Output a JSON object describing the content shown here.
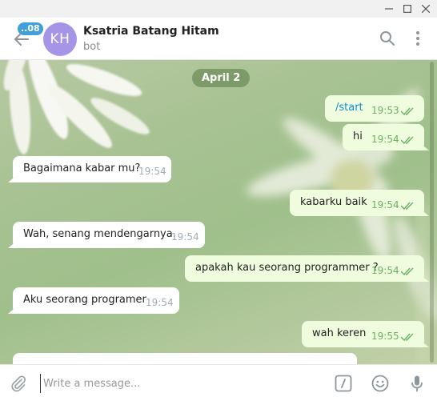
{
  "header": {
    "unread_count": "..08",
    "avatar_initials": "KH",
    "title": "Ksatria Batang Hitam",
    "subtitle": "bot"
  },
  "date_pill": "April 2",
  "messages": [
    {
      "text": "/start",
      "time": "19:53",
      "direction": "out"
    },
    {
      "text": "hi",
      "time": "19:54",
      "direction": "out"
    },
    {
      "text": "Bagaimana kabar mu?",
      "time": "19:54",
      "direction": "in"
    },
    {
      "text": "kabarku baik",
      "time": "19:54",
      "direction": "out"
    },
    {
      "text": "Wah, senang mendengarnya.",
      "time": "19:54",
      "direction": "in"
    },
    {
      "text": "apakah kau seorang programmer ?",
      "time": "19:54",
      "direction": "out"
    },
    {
      "text": "Aku seorang programer",
      "time": "19:54",
      "direction": "in"
    },
    {
      "text": "wah keren",
      "time": "19:55",
      "direction": "out"
    }
  ],
  "composer": {
    "placeholder": "Write a message..."
  },
  "icons": {
    "back": "arrow-left-icon",
    "search": "search-icon",
    "menu": "more-vertical-icon",
    "attach": "paperclip-icon",
    "commands": "slash-command-icon",
    "emoji": "smile-icon",
    "mic": "microphone-icon",
    "read": "double-check-icon"
  },
  "colors": {
    "accent": "#419fd9",
    "avatar": "#a695e7",
    "outgoing_bubble": "#effdde",
    "incoming_bubble": "#ffffff",
    "outgoing_time": "#6cb062",
    "command_link": "#168acd"
  }
}
